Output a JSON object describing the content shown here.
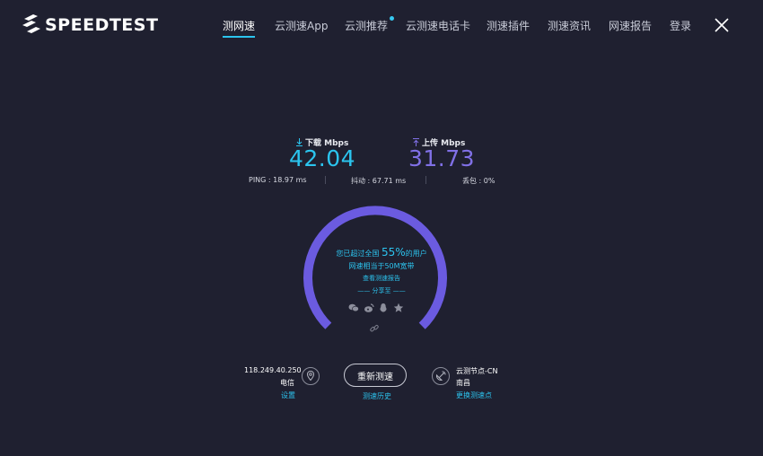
{
  "header": {
    "logo_text": "SPEEDTEST",
    "nav": [
      {
        "label": "测网速",
        "active": true
      },
      {
        "label": "云测速App"
      },
      {
        "label": "云测推荐",
        "dot": true
      },
      {
        "label": "云测速电话卡"
      },
      {
        "label": "测速插件"
      },
      {
        "label": "测速资讯"
      },
      {
        "label": "网速报告"
      },
      {
        "label": "登录"
      }
    ]
  },
  "download": {
    "label": "下载 Mbps",
    "value": "42.04",
    "color": "#2bc4ee"
  },
  "upload": {
    "label": "上传 Mbps",
    "value": "31.73",
    "color": "#8070e6"
  },
  "stats": {
    "ping": "PING : 18.97 ms",
    "jitter": "抖动 : 67.71 ms",
    "loss": "丢包 : 0%"
  },
  "gauge": {
    "text_before": "您已超过全国",
    "percent": "55%",
    "text_after": "的用户",
    "percent_value": 0.55,
    "bandwidth": "网速相当于50M宽带",
    "report_link": "查看测速报告",
    "share_label": "—— 分享至 ——",
    "arc_color": "#6b5be0"
  },
  "footer": {
    "ip": "118.249.40.250",
    "isp": "电信",
    "settings": "设置",
    "retest": "重新测速",
    "history": "测速历史",
    "node": "云测节点-CN",
    "city": "南昌",
    "change_node": "更换测速点"
  },
  "icons": [
    "logo-s-icon",
    "download-arrow-icon",
    "upload-arrow-icon",
    "wechat-icon",
    "weibo-icon",
    "qq-icon",
    "star-icon",
    "link-icon",
    "location-pin-icon",
    "satellite-icon",
    "close-icon"
  ]
}
